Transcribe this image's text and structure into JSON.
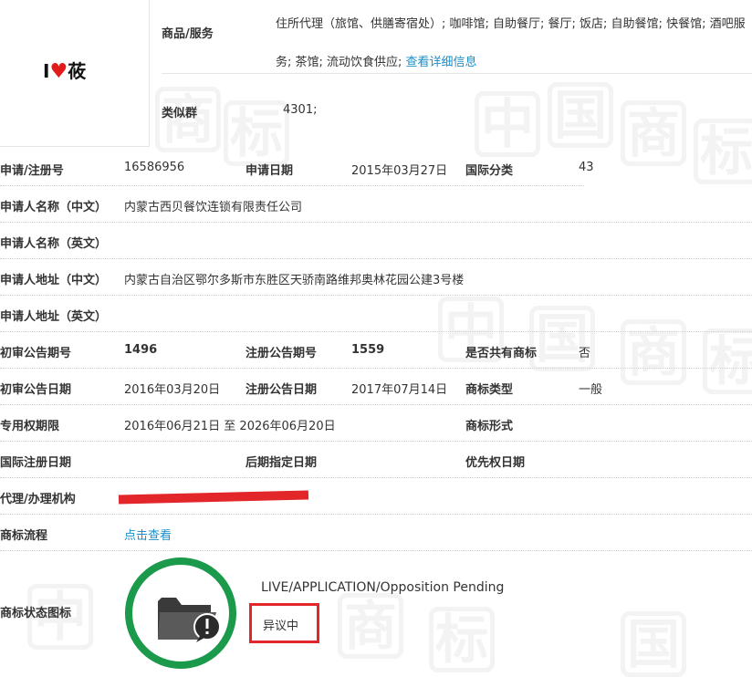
{
  "brand": {
    "logo_prefix": "I",
    "logo_suffix": "莜"
  },
  "goods": {
    "label": "商品/服务",
    "text": "住所代理（旅馆、供膳寄宿处）; 咖啡馆; 自助餐厅; 餐厅; 饭店; 自助餐馆; 快餐馆; 酒吧服务; 茶馆; 流动饮食供应;",
    "detail_link": "查看详细信息"
  },
  "similar": {
    "label": "类似群",
    "value": "4301;"
  },
  "fields": {
    "reg_no_label": "申请/注册号",
    "reg_no": "16586956",
    "apply_date_label": "申请日期",
    "apply_date": "2015年03月27日",
    "intl_class_label": "国际分类",
    "intl_class": "43",
    "applicant_cn_label": "申请人名称（中文）",
    "applicant_cn": "内蒙古西贝餐饮连锁有限责任公司",
    "applicant_en_label": "申请人名称（英文）",
    "address_cn_label": "申请人地址（中文）",
    "address_cn": "内蒙古自治区鄂尔多斯市东胜区天骄南路维邦奥林花园公建3号楼",
    "address_en_label": "申请人地址（英文）",
    "prelim_no_label": "初审公告期号",
    "prelim_no": "1496",
    "reg_pub_no_label": "注册公告期号",
    "reg_pub_no": "1559",
    "shared_label": "是否共有商标",
    "shared": "否",
    "prelim_date_label": "初审公告日期",
    "prelim_date": "2016年03月20日",
    "reg_pub_date_label": "注册公告日期",
    "reg_pub_date": "2017年07月14日",
    "mark_type_label": "商标类型",
    "mark_type": "一般",
    "exclusive_label": "专用权期限",
    "exclusive": "2016年06月21日 至 2026年06月20日",
    "mark_form_label": "商标形式",
    "intl_reg_date_label": "国际注册日期",
    "later_date_label": "后期指定日期",
    "priority_label": "优先权日期",
    "agency_label": "代理/办理机构",
    "flow_label": "商标流程",
    "flow_link": "点击查看",
    "status_icon_label": "商标状态图标"
  },
  "status": {
    "english": "LIVE/APPLICATION/Opposition Pending",
    "chinese": "异议中"
  },
  "watermark": {
    "char_a": "中",
    "char_b": "国",
    "char_c": "商",
    "char_d": "标"
  },
  "colors": {
    "accent_green": "#1a9a4a",
    "highlight_red": "#e2262a",
    "link_blue": "#1a8fc9"
  }
}
